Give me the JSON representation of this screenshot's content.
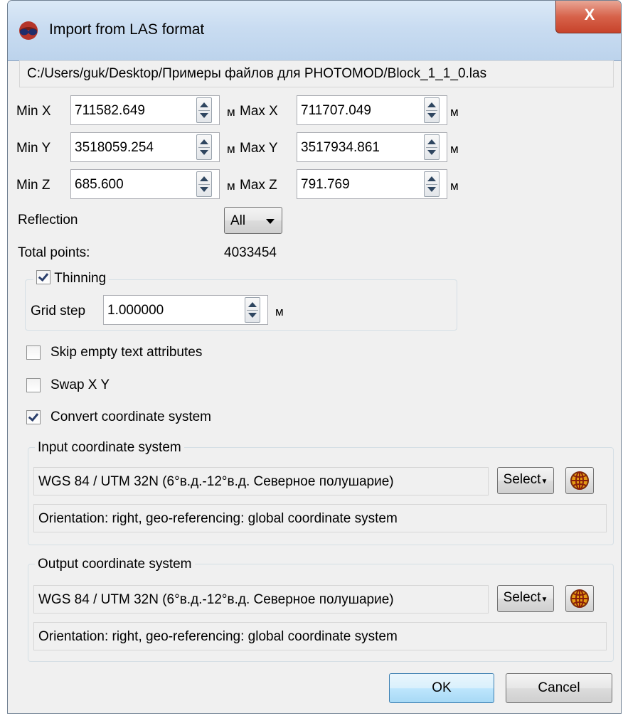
{
  "window": {
    "title": "Import from LAS format",
    "close_label": "X"
  },
  "file_path": "C:/Users/guk/Desktop/Примеры файлов для PHOTOMOD/Block_1_1_0.las",
  "unit": "м",
  "ranges": {
    "min_x": {
      "label": "Min X",
      "value": "711582.649"
    },
    "max_x": {
      "label": "Max X",
      "value": "711707.049"
    },
    "min_y": {
      "label": "Min Y",
      "value": "3518059.254"
    },
    "max_y": {
      "label": "Max Y",
      "value": "3517934.861"
    },
    "min_z": {
      "label": "Min Z",
      "value": "685.600"
    },
    "max_z": {
      "label": "Max Z",
      "value": "791.769"
    }
  },
  "reflection": {
    "label": "Reflection",
    "value": "All"
  },
  "total_points": {
    "label": "Total points:",
    "value": "4033454"
  },
  "thinning": {
    "label": "Thinning",
    "checked": true,
    "grid_step_label": "Grid step",
    "grid_step_value": "1.000000"
  },
  "options": {
    "skip_empty": {
      "label": "Skip empty text attributes",
      "checked": false
    },
    "swap_xy": {
      "label": "Swap X Y",
      "checked": false
    },
    "convert_cs": {
      "label": "Convert coordinate system",
      "checked": true
    }
  },
  "input_cs": {
    "legend": "Input coordinate system",
    "name": "WGS 84 / UTM 32N (6°в.д.-12°в.д. Северное полушарие)",
    "select_label": "Select",
    "info": "Orientation: right, geo-referencing: global coordinate system"
  },
  "output_cs": {
    "legend": "Output coordinate system",
    "name": "WGS 84 / UTM 32N (6°в.д.-12°в.д. Северное полушарие)",
    "select_label": "Select",
    "info": "Orientation: right, geo-referencing: global coordinate system"
  },
  "buttons": {
    "ok": "OK",
    "cancel": "Cancel"
  },
  "colors": {
    "titlebar": "#c9dcf1",
    "close": "#c7432b",
    "default_button": "#a7d9f5"
  }
}
